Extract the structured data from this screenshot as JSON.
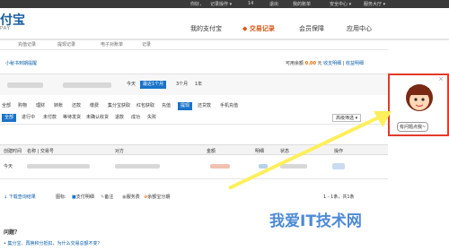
{
  "topbar": {
    "greeting": "你好，",
    "user_menu": "记录操作 ▾",
    "msg_count": "14",
    "logout": "退出",
    "orders": "我的账单",
    "security": "安全中心 ▾",
    "service": "服务大厅 ▾"
  },
  "header": {
    "logo": "付宝",
    "logo_sub": "PAY",
    "nav": [
      "我的支付宝",
      "交易记录",
      "会员保障",
      "应用中心"
    ],
    "active_nav": 1
  },
  "subnav": [
    "充值记录",
    "提现记录",
    "电子对账单",
    "记录"
  ],
  "notice": {
    "left": "小秘书到期提醒",
    "right_prefix": "可用余额",
    "amount": "0.00",
    "unit": "元",
    "link1": "收支明细",
    "link2": "收益明细"
  },
  "filter": {
    "date_quick": [
      "今天",
      "最近1个月",
      "3个月",
      "1年"
    ],
    "date_active": 1,
    "types": [
      "全部",
      "购物",
      "理财",
      "转账",
      "还款",
      "缴费",
      "集分宝获取",
      "红包获取",
      "充值",
      "提现",
      "还贷款",
      "手机充值"
    ],
    "type_active": 9,
    "status": [
      "全部",
      "进行中",
      "未付款",
      "等待发货",
      "未确认收货",
      "退款",
      "成功",
      "失败"
    ],
    "status_active": 0,
    "advanced": "高级筛选 ▾"
  },
  "table": {
    "headers": [
      "创建时间",
      "名称 | 交易号",
      "对方",
      "金额",
      "明细",
      "状态",
      "操作"
    ],
    "row_time": "今天"
  },
  "footer": {
    "download": "↓ 下载查询结果",
    "legend_label": "图标:",
    "legends": [
      "支付明细",
      "备注",
      "服务费",
      "余额宝分期"
    ],
    "pagination": "1 - 1条，共1条"
  },
  "faq": {
    "q1": "问题？",
    "q2": "• 集分宝、再换积分抵扣，为什么交易总额不变？"
  },
  "side_panel": {
    "button": "有问题点我~",
    "close": "×"
  },
  "watermark": "我爱IT技术网"
}
